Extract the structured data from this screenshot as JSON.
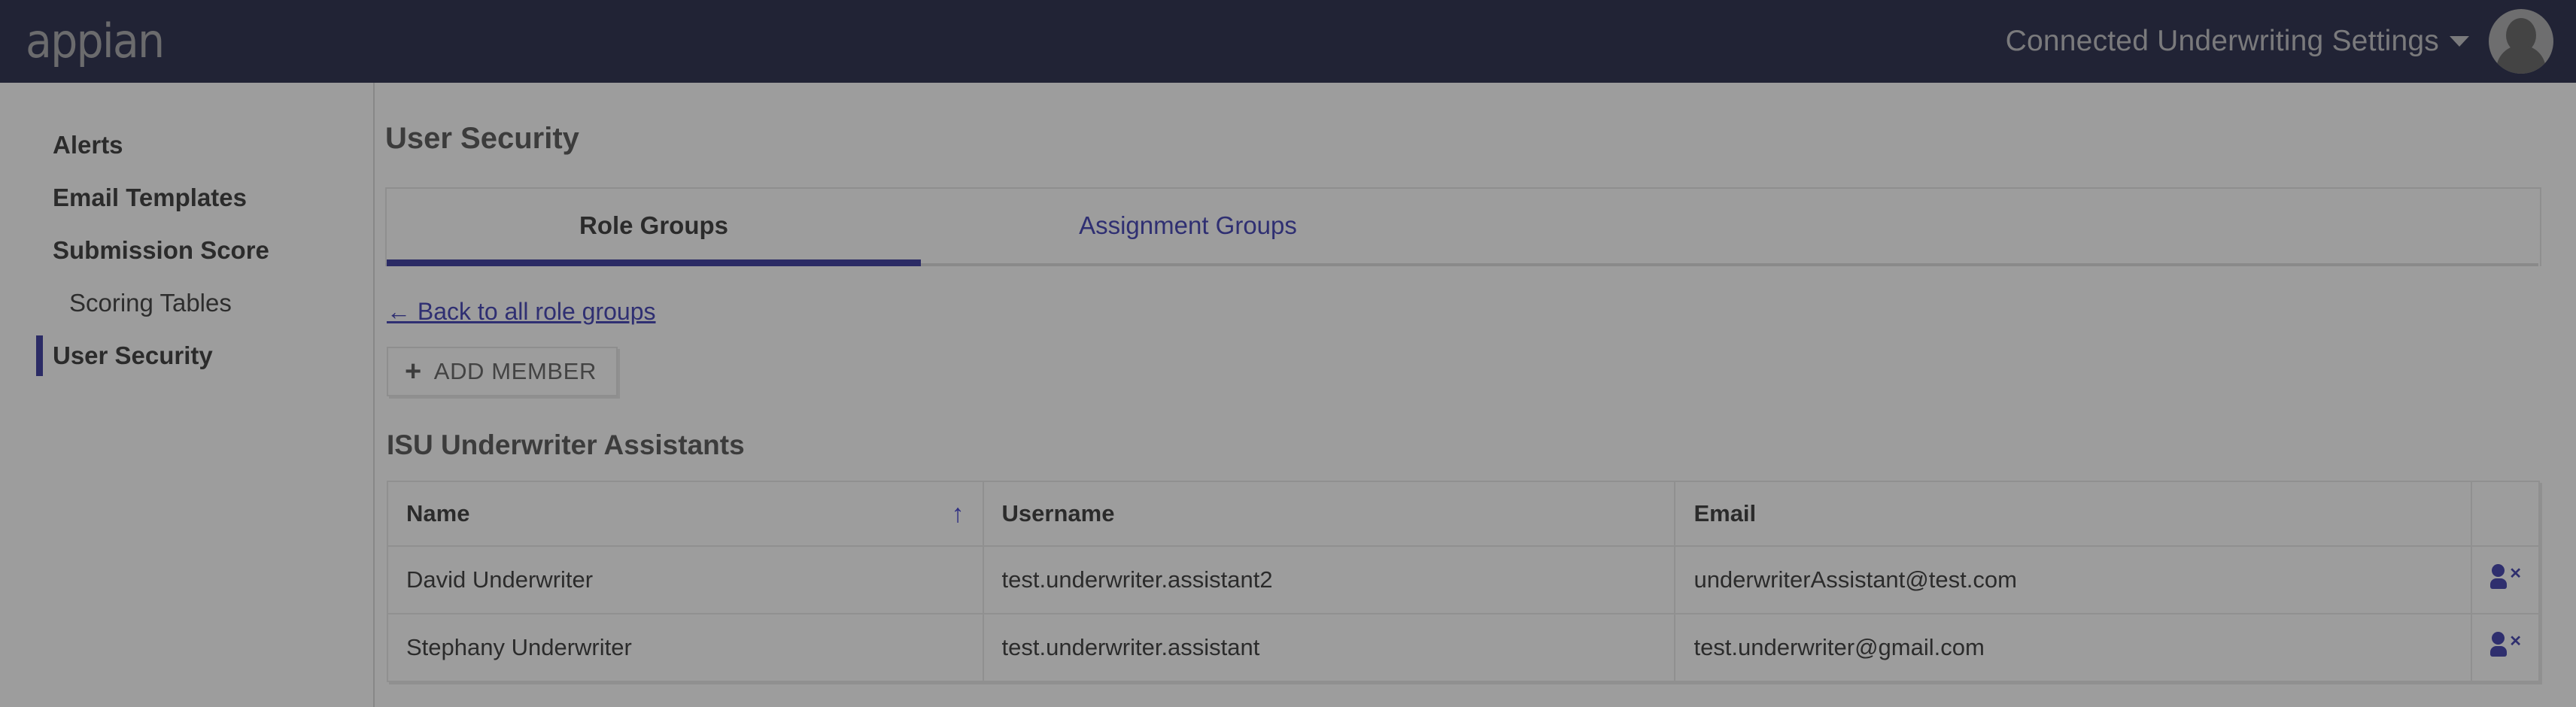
{
  "header": {
    "logo_text": "appian",
    "site_title": "Connected Underwriting Settings",
    "caret_icon": "chevron-down-icon",
    "avatar_icon": "user-avatar-icon"
  },
  "sidebar": {
    "items": [
      {
        "label": "Alerts",
        "level": "top",
        "selected": false
      },
      {
        "label": "Email Templates",
        "level": "top",
        "selected": false
      },
      {
        "label": "Submission Score",
        "level": "top",
        "selected": false
      },
      {
        "label": "Scoring Tables",
        "level": "sub",
        "selected": false
      },
      {
        "label": "User Security",
        "level": "top",
        "selected": true
      }
    ]
  },
  "main": {
    "page_title": "User Security",
    "tabs": [
      {
        "label": "Role Groups",
        "active": true
      },
      {
        "label": "Assignment Groups",
        "active": false
      }
    ],
    "back_link": "← Back to all role groups",
    "add_member_button": {
      "icon": "plus-icon",
      "icon_glyph": "+",
      "label": "ADD MEMBER"
    },
    "group_title": "ISU Underwriter Assistants",
    "table": {
      "columns": [
        "Name",
        "Username",
        "Email",
        ""
      ],
      "sort": {
        "column": "Name",
        "direction": "ascending",
        "glyph": "↑"
      },
      "rows": [
        {
          "name": "David Underwriter",
          "username": "test.underwriter.assistant2",
          "email": "underwriterAssistant@test.com",
          "action_icon": "remove-user-icon"
        },
        {
          "name": "Stephany Underwriter",
          "username": "test.underwriter.assistant",
          "email": "test.underwriter@gmail.com",
          "action_icon": "remove-user-icon"
        }
      ]
    }
  },
  "colors": {
    "topbar_background": "#060a2e",
    "accent_blue": "#1b1b8f",
    "link_blue": "#2222a8",
    "page_background": "#ffffff",
    "overlay_dim": "rgba(60,60,60,0.50)"
  }
}
